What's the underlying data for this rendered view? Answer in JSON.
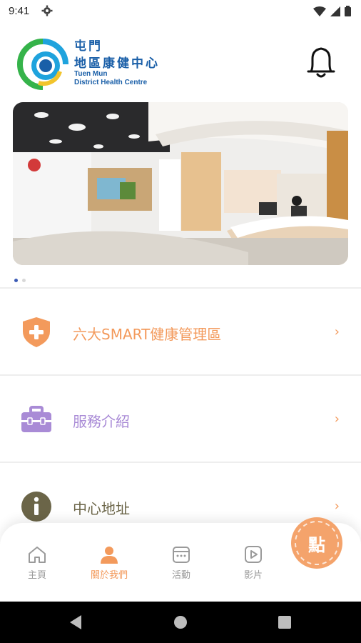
{
  "status_bar": {
    "time": "9:41"
  },
  "logo": {
    "cn_line1": "屯門",
    "cn_line2": "地區康健中心",
    "en_line1": "Tuen Mun",
    "en_line2": "District Health Centre"
  },
  "carousel": {
    "total": 2,
    "active": 1
  },
  "menu": [
    {
      "label": "六大SMART健康管理區",
      "icon": "shield-plus-icon",
      "color": "#f39a5c"
    },
    {
      "label": "服務介紹",
      "icon": "toolbox-icon",
      "color": "#a98bd6"
    },
    {
      "label": "中心地址",
      "icon": "info-icon",
      "color": "#6b6548"
    }
  ],
  "tabbar": {
    "tabs": [
      {
        "label": "主頁",
        "icon": "home-icon",
        "active": false
      },
      {
        "label": "關於我們",
        "icon": "person-icon",
        "active": true
      },
      {
        "label": "活動",
        "icon": "calendar-icon",
        "active": false
      },
      {
        "label": "影片",
        "icon": "video-icon",
        "active": false
      }
    ],
    "fab_label": "點"
  },
  "colors": {
    "accent": "#f39a5c",
    "brand_blue": "#1a5fa8"
  }
}
